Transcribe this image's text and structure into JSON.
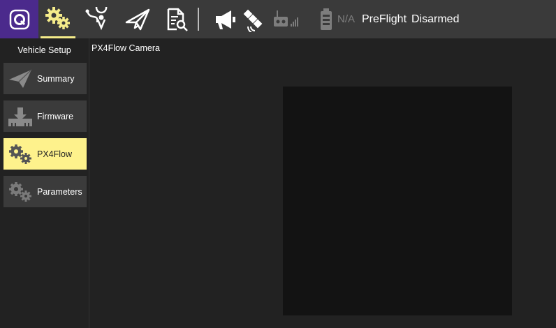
{
  "toolbar": {
    "items": [
      {
        "icon": "qgc-logo-icon"
      },
      {
        "icon": "vehicle-setup-gears-icon",
        "active": true
      },
      {
        "icon": "plan-route-icon"
      },
      {
        "icon": "fly-paper-plane-icon"
      },
      {
        "icon": "analyze-document-icon"
      }
    ],
    "status": {
      "battery_text": "N/A",
      "flight_mode": "PreFlight",
      "arm_state": "Disarmed"
    },
    "colors": {
      "accent": "#f5ec8a",
      "logo_bg": "#4b2a8c",
      "bar_bg": "#3a3a3a"
    }
  },
  "sidebar": {
    "title": "Vehicle Setup",
    "items": [
      {
        "label": "Summary",
        "icon": "summary-plane-icon",
        "selected": false
      },
      {
        "label": "Firmware",
        "icon": "firmware-download-icon",
        "selected": false
      },
      {
        "label": "PX4Flow",
        "icon": "px4flow-gears-icon",
        "selected": true
      },
      {
        "label": "Parameters",
        "icon": "parameters-gears-icon",
        "selected": false
      }
    ]
  },
  "main": {
    "title": "PX4Flow Camera"
  }
}
